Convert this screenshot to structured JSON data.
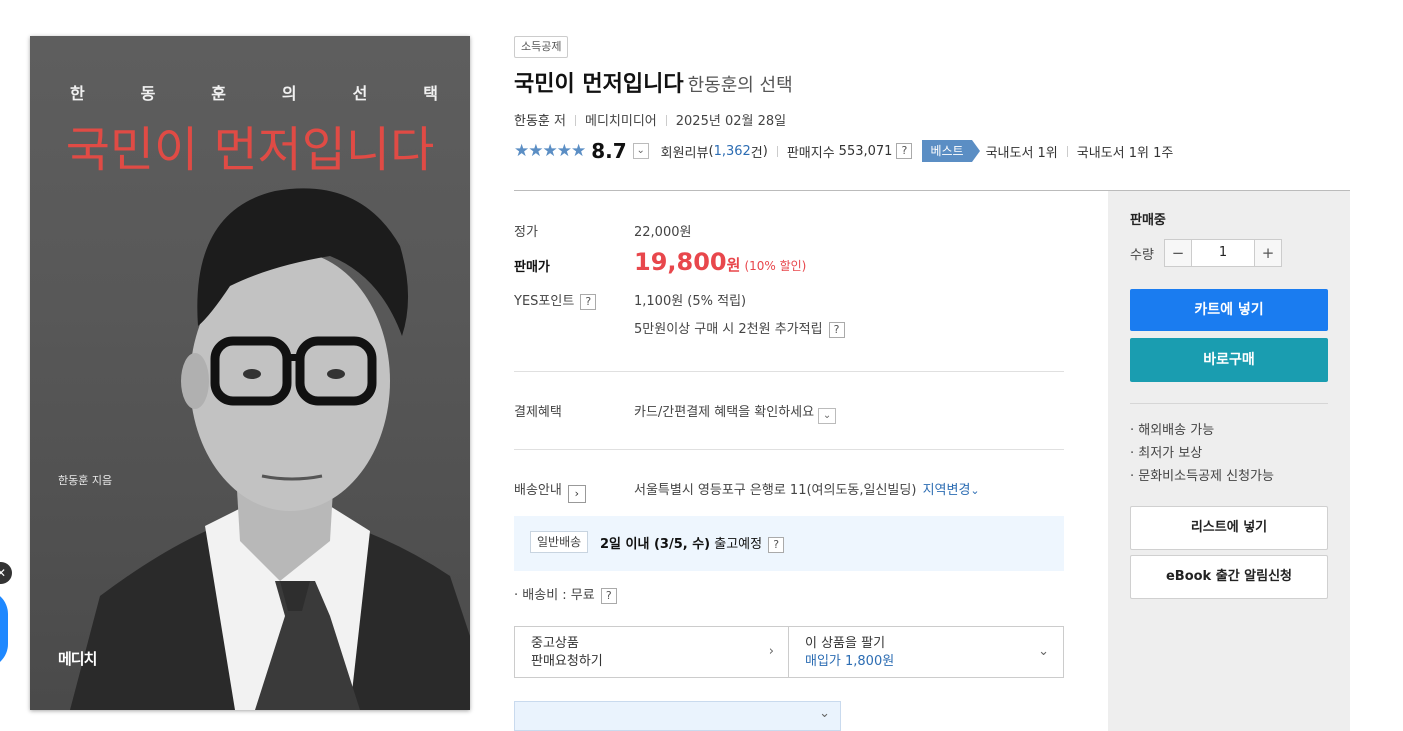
{
  "cover": {
    "subtitle_chars": [
      "한",
      "동",
      "훈",
      "의",
      "선",
      "택"
    ],
    "title": "국민이 먼저입니다",
    "author": "한동훈 지음",
    "logo": "메디치"
  },
  "header": {
    "tag": "소득공제",
    "title": "국민이 먼저입니다",
    "subtitle": "한동훈의 선택",
    "author": "한동훈",
    "author_role": "저",
    "publisher": "메디치미디어",
    "date": "2025년 02월 28일"
  },
  "rating": {
    "stars": "★★★★★",
    "score": "8.7",
    "review_label": "회원리뷰",
    "review_count": "1,362",
    "review_unit": "건",
    "sales_label": "판매지수",
    "sales_value": "553,071",
    "best_label": "베스트",
    "rank1": "국내도서 1위",
    "rank2": "국내도서 1위 1주"
  },
  "price": {
    "list_label": "정가",
    "list_value": "22,000원",
    "sale_label": "판매가",
    "sale_value": "19,800",
    "sale_unit": "원",
    "discount": "(10% 할인)",
    "points_label": "YES포인트",
    "points_value": "1,100원 (5% 적립)",
    "points_extra": "5만원이상 구매 시 2천원 추가적립"
  },
  "payment": {
    "label": "결제혜택",
    "value": "카드/간편결제 혜택을 확인하세요"
  },
  "shipping": {
    "label": "배송안내",
    "address": "서울특별시 영등포구 은행로 11(여의도동,일신빌딩)",
    "change": "지역변경",
    "badge": "일반배송",
    "eta_bold": "2일 이내 (3/5, 수)",
    "eta_rest": "출고예정",
    "fee": "배송비 : 무료"
  },
  "used": {
    "left_line1": "중고상품",
    "left_line2": "판매요청하기",
    "right_line1": "이 상품을 팔기",
    "right_line2": "매입가 1,800원"
  },
  "side": {
    "status": "판매중",
    "qty_label": "수량",
    "qty_value": "1",
    "cart": "카트에 넣기",
    "buy": "바로구매",
    "benefits": [
      "해외배송 가능",
      "최저가 보상",
      "문화비소득공제 신청가능"
    ],
    "wishlist": "리스트에 넣기",
    "ebook": "eBook 출간 알림신청"
  },
  "colors": {
    "accent_blue": "#1a7cf0",
    "buy_teal": "#1a9db0",
    "sale_red": "#e8474c",
    "best_blue": "#5b8ec4",
    "cover_title_red": "#e04b45"
  }
}
